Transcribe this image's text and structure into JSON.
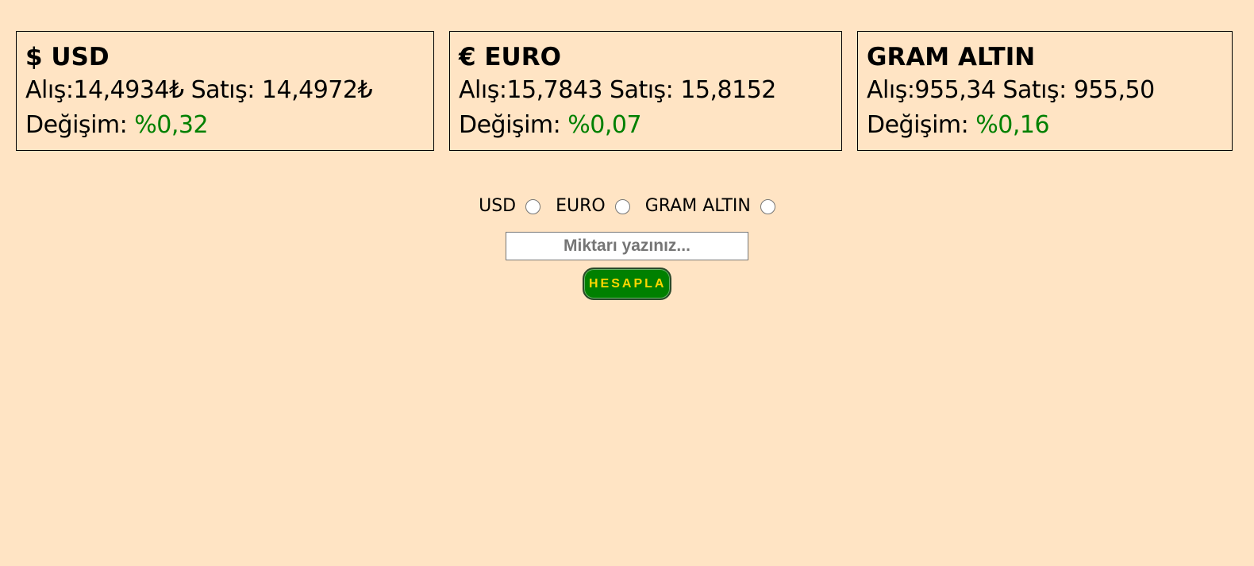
{
  "cards": {
    "usd": {
      "title": "$ USD",
      "rates": "Alış:14,4934₺ Satış: 14,4972₺",
      "change_label": "Değişim: ",
      "change_value": "%0,32"
    },
    "euro": {
      "title": "€ EURO",
      "rates": "Alış:15,7843 Satış: 15,8152",
      "change_label": "Değişim: ",
      "change_value": "%0,07"
    },
    "gold": {
      "title": "GRAM ALTIN",
      "rates": "Alış:955,34 Satış: 955,50",
      "change_label": "Değişim: ",
      "change_value": "%0,16"
    }
  },
  "selector": {
    "options": [
      "USD",
      "EURO",
      "GRAM ALTIN"
    ]
  },
  "amount": {
    "placeholder": "Miktarı yazınız...",
    "value": ""
  },
  "calculate": {
    "label": "HESAPLA"
  },
  "colors": {
    "background": "#ffe4c4",
    "change_positive": "#008000",
    "button_bg": "#008000",
    "button_text": "#ffd700"
  }
}
